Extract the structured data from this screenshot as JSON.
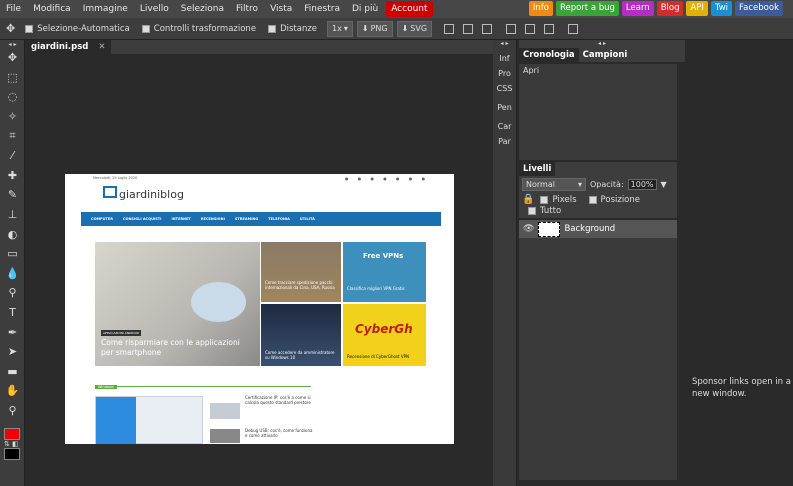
{
  "menu": [
    "File",
    "Modifica",
    "Immagine",
    "Livello",
    "Seleziona",
    "Filtro",
    "Vista",
    "Finestra",
    "Di più"
  ],
  "account_label": "Account",
  "ext_buttons": [
    {
      "label": "Info",
      "color": "#f28a0c"
    },
    {
      "label": "Report a bug",
      "color": "#3aa33a"
    },
    {
      "label": "Learn",
      "color": "#b52dc4"
    },
    {
      "label": "Blog",
      "color": "#d12d2d"
    },
    {
      "label": "API",
      "color": "#e0b100"
    },
    {
      "label": "Twi",
      "color": "#1a8fd1"
    },
    {
      "label": "Facebook",
      "color": "#3b5b9a"
    }
  ],
  "options": {
    "auto_select": "Selezione-Automatica",
    "transform_controls": "Controlli trasformazione",
    "distances": "Distanze",
    "zoom": "1x",
    "png": "PNG",
    "svg": "SVG"
  },
  "doc_tab": "giardini.psd",
  "doc_tab_close": "✕",
  "side_tabs": [
    "Inf",
    "Pro",
    "CSS",
    "Pen",
    "Car",
    "Par"
  ],
  "history_tabs": [
    "Cronologia",
    "Campioni"
  ],
  "history_items": [
    "Apri"
  ],
  "layers_tab": "Livelli",
  "blend_mode": "Normal",
  "opacity_label": "Opacità:",
  "opacity_value": "100%",
  "lock_labels": {
    "pixels": "Pixels",
    "position": "Posizione",
    "all": "Tutto"
  },
  "layer_name": "Background",
  "sponsor_text": "Sponsor links open in a new window.",
  "panel_collapse": "◂ ▸",
  "webpage": {
    "date": "Mercoledì, 29 luglio 2020",
    "logo": "giardiniblog",
    "nav": [
      "COMPUTER",
      "CONSIGLI ACQUISTI",
      "INTERNET",
      "RECENSIONI",
      "STREAMING",
      "TELEFONIA",
      "UTILITÀ"
    ],
    "hero_badge": "APPLICAZIONI ANDROID",
    "hero_title": "Come risparmiare con le applicazioni per smartphone",
    "card1_title": "Come tracciare spedizione pacchi internazionali da Cina, USA, Russia",
    "card2_tag": "Free VPNs",
    "card2_title": "Classifica migliori VPN Gratis",
    "card3_title": "Come accedere da amministratore su Windows 10",
    "card4_brand": "CyberGh",
    "card4_title": "Recensione di CyberGhost VPN",
    "section_tag": "Windows",
    "side_item1": "Certificazione IP: cos'è a come si calcola questo standard prestore",
    "side_item2": "Debug USB: cos'è, come funziona e come attivarlo"
  }
}
